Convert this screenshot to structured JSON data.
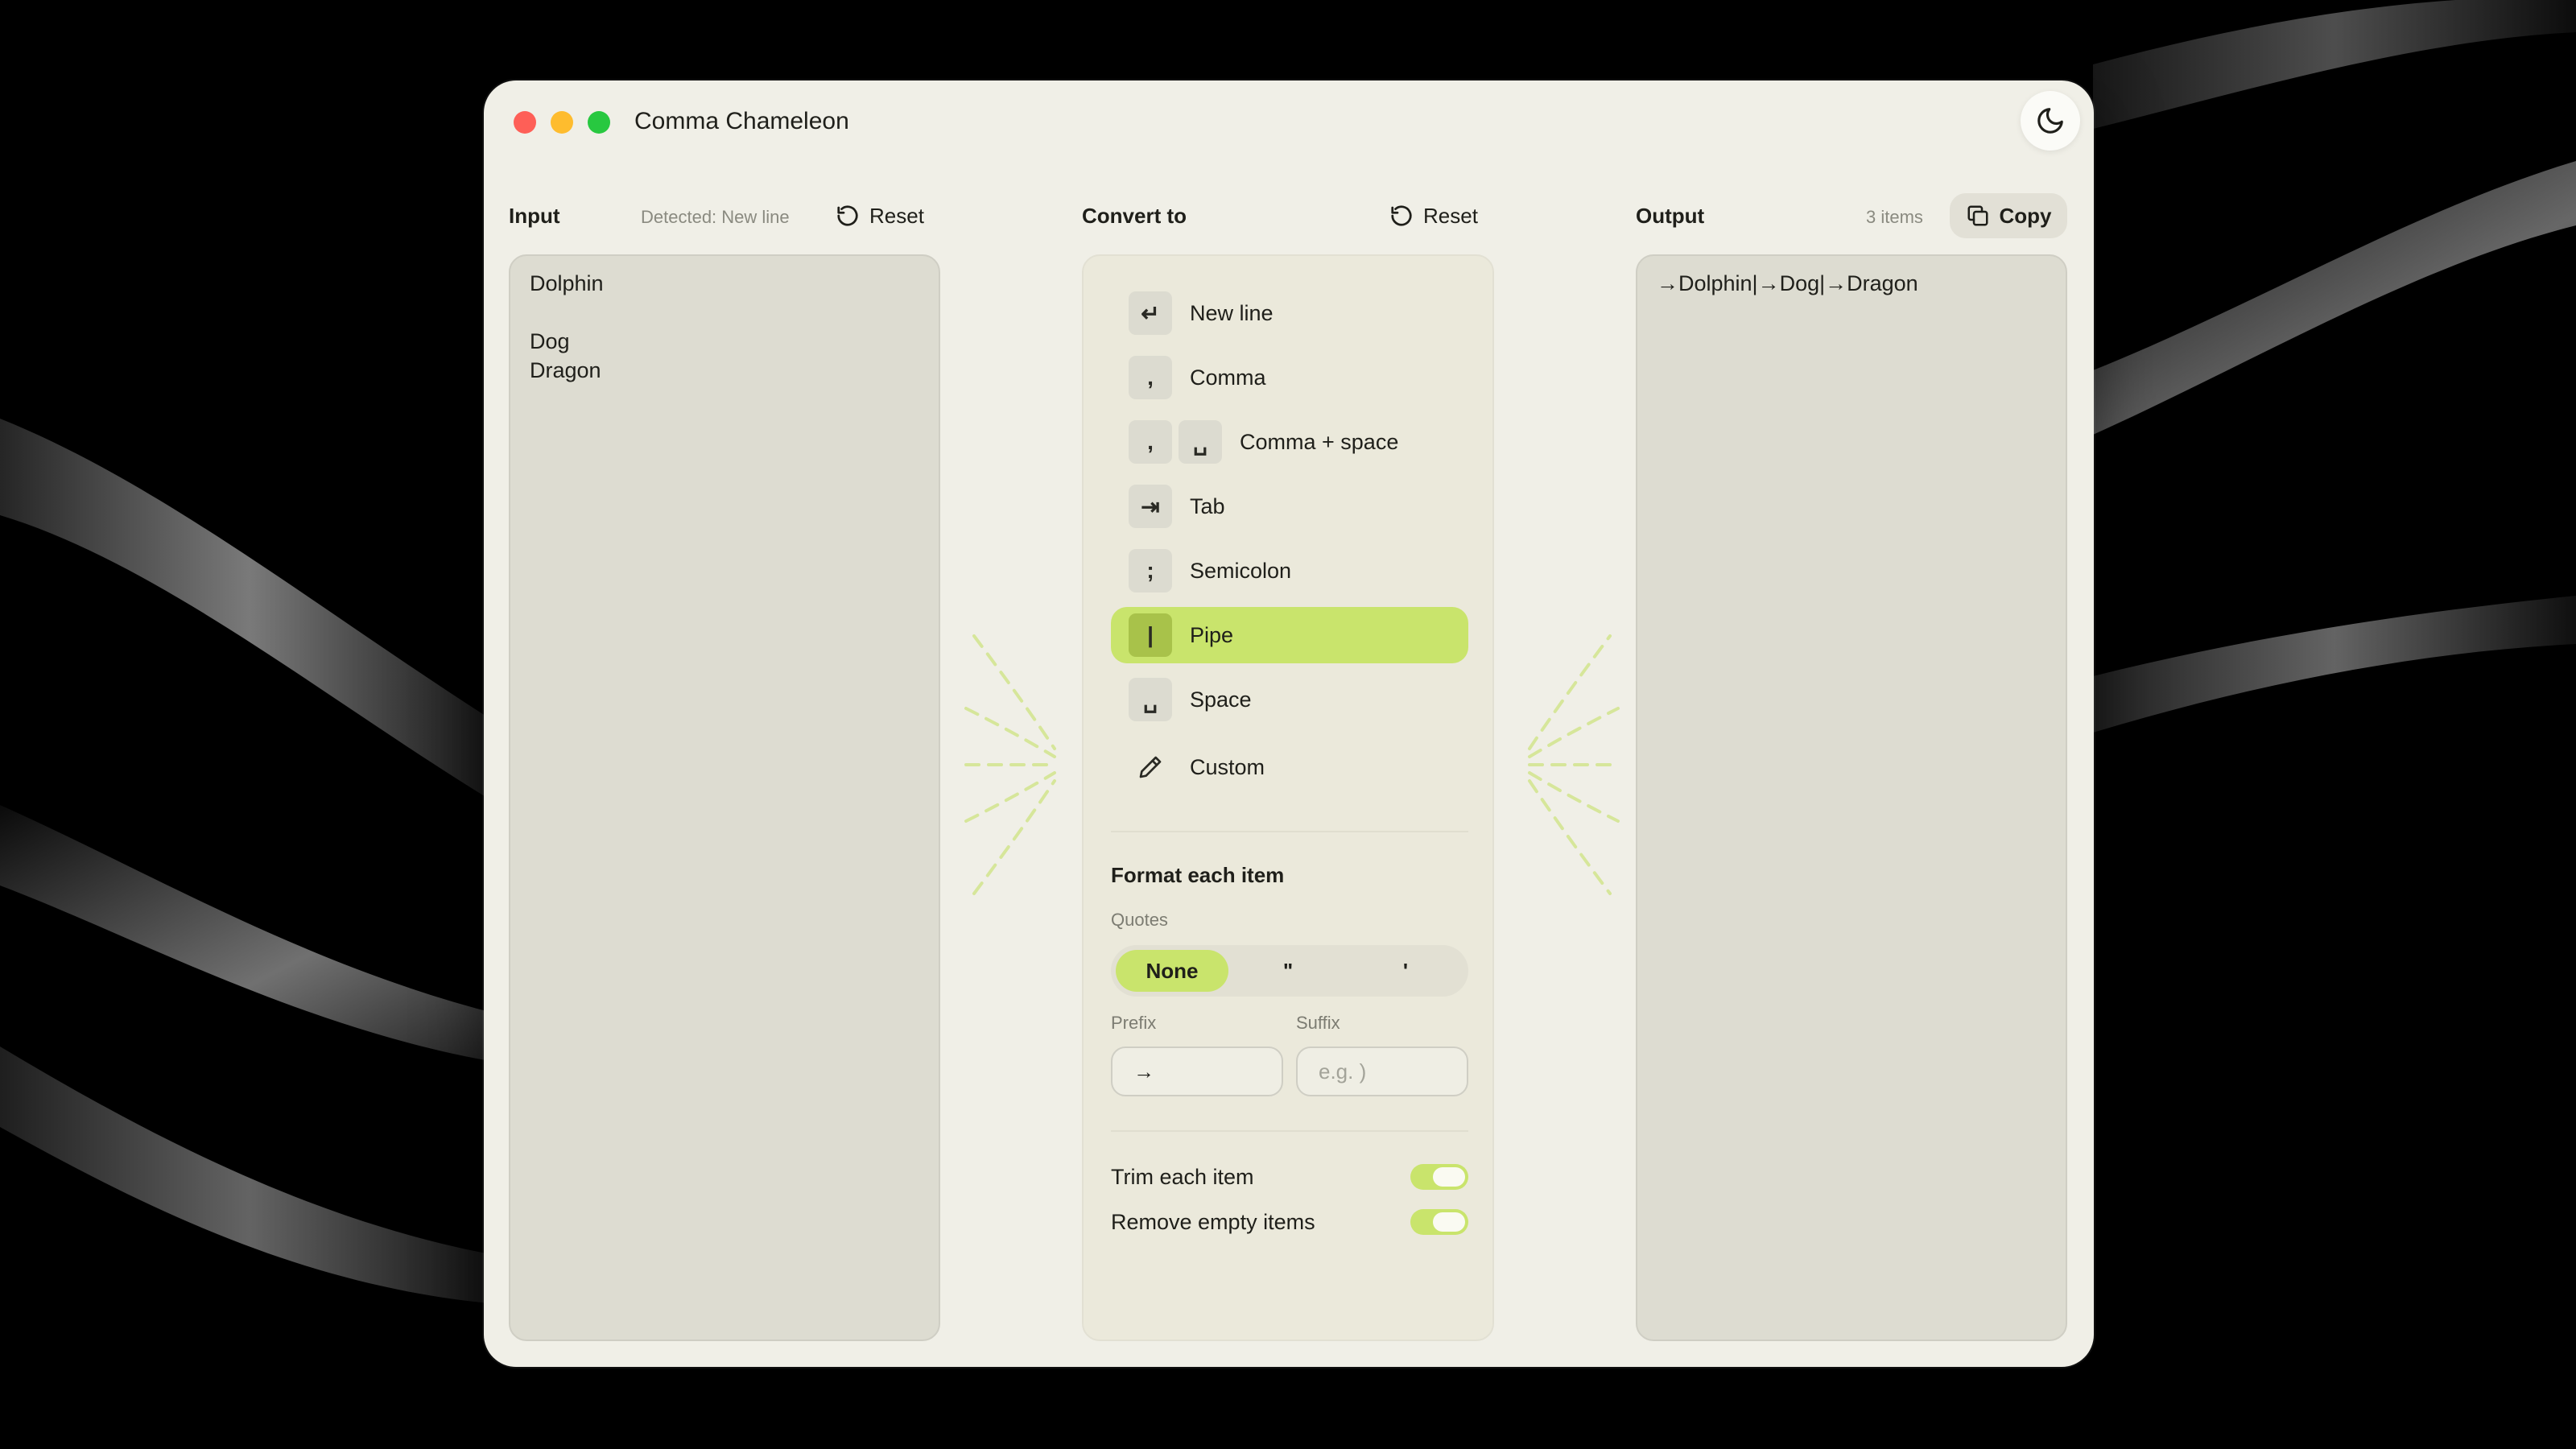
{
  "window": {
    "title": "Comma Chameleon"
  },
  "input": {
    "header": "Input",
    "detected": "Detected: New line",
    "reset_label": "Reset",
    "text": "Dolphin\n\nDog\nDragon"
  },
  "convert": {
    "header": "Convert to",
    "reset_label": "Reset",
    "options": [
      {
        "label": "New line",
        "keys": [
          "↵"
        ],
        "selected": false
      },
      {
        "label": "Comma",
        "keys": [
          ","
        ],
        "selected": false
      },
      {
        "label": "Comma + space",
        "keys": [
          ",",
          "␣"
        ],
        "selected": false
      },
      {
        "label": "Tab",
        "keys": [
          "⇥"
        ],
        "selected": false
      },
      {
        "label": "Semicolon",
        "keys": [
          ";"
        ],
        "selected": false
      },
      {
        "label": "Pipe",
        "keys": [
          "|"
        ],
        "selected": true
      },
      {
        "label": "Space",
        "keys": [
          "␣"
        ],
        "selected": false
      },
      {
        "label": "Custom",
        "icon": "pencil-icon",
        "selected": false
      }
    ],
    "format_title": "Format each item",
    "quotes_label": "Quotes",
    "quote_options": [
      "None",
      "\"",
      "'"
    ],
    "quote_selected": "None",
    "prefix_label": "Prefix",
    "prefix_value": "→",
    "suffix_label": "Suffix",
    "suffix_placeholder": "e.g. )",
    "trim_label": "Trim each item",
    "trim_on": true,
    "remove_empty_label": "Remove empty items",
    "remove_empty_on": true
  },
  "output": {
    "header": "Output",
    "count": "3 items",
    "copy_label": "Copy",
    "text": "→Dolphin|→Dog|→Dragon"
  },
  "colors": {
    "accent": "#c9e46c",
    "window_bg": "#f0efe7",
    "panel_bg": "#dddcd1"
  }
}
